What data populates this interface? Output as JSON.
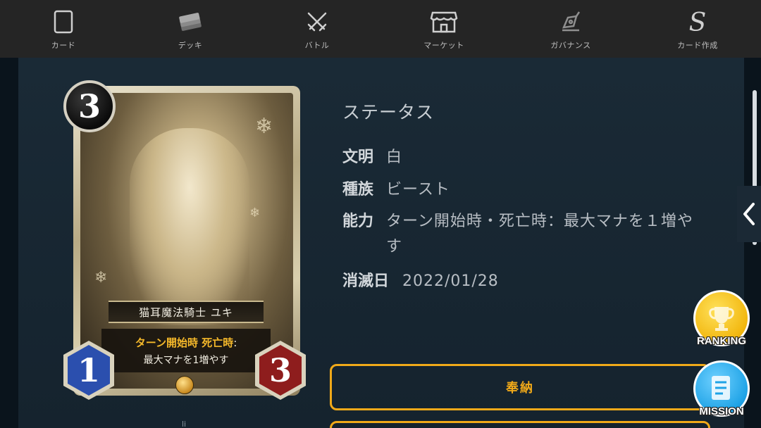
{
  "nav": {
    "items": [
      {
        "label": "カード",
        "icon": "card-icon"
      },
      {
        "label": "デッキ",
        "icon": "deck-icon"
      },
      {
        "label": "バトル",
        "icon": "battle-icon"
      },
      {
        "label": "マーケット",
        "icon": "market-icon"
      },
      {
        "label": "ガバナンス",
        "icon": "governance-icon"
      },
      {
        "label": "カード作成",
        "icon": "card-create-icon"
      }
    ]
  },
  "card": {
    "cost": "3",
    "name": "猫耳魔法騎士 ユキ",
    "ability_head_1": "ターン開始時",
    "ability_head_2": "死亡時",
    "ability_colon": ":",
    "ability_body": "最大マナを1増やす",
    "attack": "1",
    "health": "3"
  },
  "status": {
    "title": "ステータス",
    "rows": [
      {
        "key": "文明",
        "value": "白"
      },
      {
        "key": "種族",
        "value": "ビースト"
      },
      {
        "key": "能力",
        "value": "ターン開始時・死亡時：最大マナを１増やす"
      },
      {
        "key": "消滅日",
        "value": "2022/01/28"
      }
    ]
  },
  "buttons": {
    "offer_label": "奉納"
  },
  "floating": {
    "ranking_label": "RANKING",
    "mission_label": "MISSION"
  },
  "footer": {
    "partial_text": "li"
  },
  "colors": {
    "accent": "#f0a919",
    "nav_bg": "#252525",
    "panel_bg": "#1a2a36",
    "ranking": "#f4c21b",
    "mission": "#1fa3e6"
  }
}
